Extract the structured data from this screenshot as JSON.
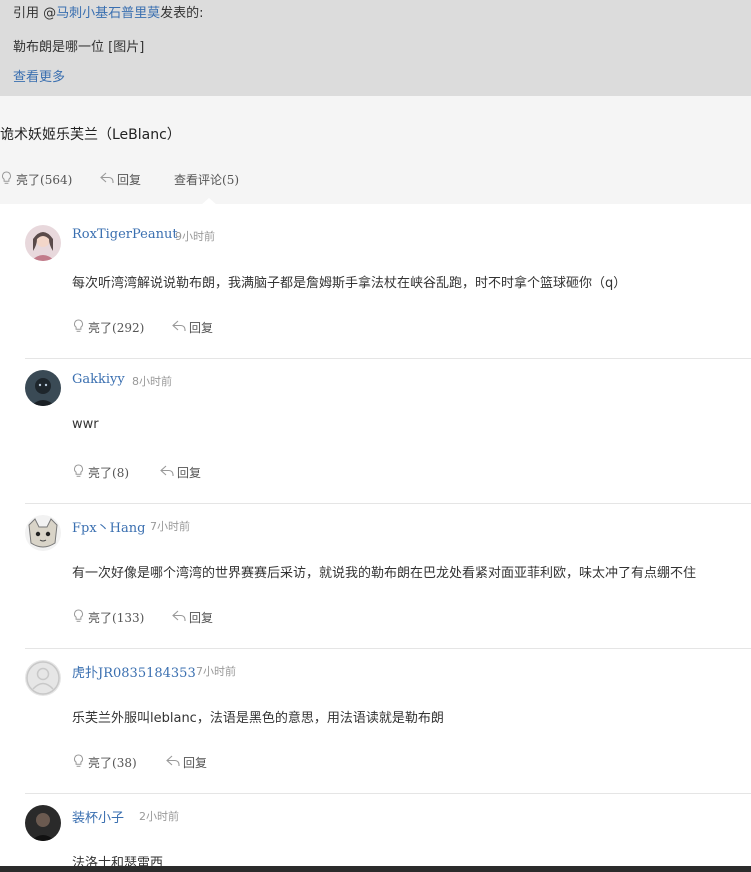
{
  "quote": {
    "prefix": "引用 @",
    "user": "马刺小基石普里莫",
    "suffix": "发表的:",
    "text": "勒布朗是哪一位 [图片]",
    "more": "查看更多"
  },
  "answer": {
    "text": "诡术妖姬乐芙兰（LeBlanc）",
    "like_label": "亮了",
    "like_count": "(564)",
    "reply_label": "回复",
    "comments_label": "查看评论",
    "comments_count": "(5)"
  },
  "colors": {
    "link": "#3a6fb0",
    "quote_bg": "#dcdcdc",
    "panel_bg": "#ffffff"
  },
  "comments": [
    {
      "name": "RoxTigerPeanut",
      "time": "9小时前",
      "text": "每次听湾湾解说说勒布朗，我满脑子都是詹姆斯手拿法杖在峡谷乱跑，时不时拿个篮球砸你（q）",
      "like_label": "亮了",
      "like_count": "(292)",
      "reply_label": "回复"
    },
    {
      "name": "Gakkiyy",
      "time": "8小时前",
      "text": "wwr",
      "like_label": "亮了",
      "like_count": "(8)",
      "reply_label": "回复"
    },
    {
      "name": "Fpx丶Hang",
      "time": "7小时前",
      "text": "有一次好像是哪个湾湾的世界赛赛后采访，就说我的勒布朗在巴龙处看紧对面亚菲利欧，味太冲了有点绷不住",
      "like_label": "亮了",
      "like_count": "(133)",
      "reply_label": "回复"
    },
    {
      "name": "虎扑JR0835184353",
      "time": "7小时前",
      "text": "乐芙兰外服叫leblanc，法语是黑色的意思，用法语读就是勒布朗",
      "like_label": "亮了",
      "like_count": "(38)",
      "reply_label": "回复"
    },
    {
      "name": "装杯小子",
      "time": "2小时前",
      "text": "法洛士和瑟雷西"
    }
  ]
}
